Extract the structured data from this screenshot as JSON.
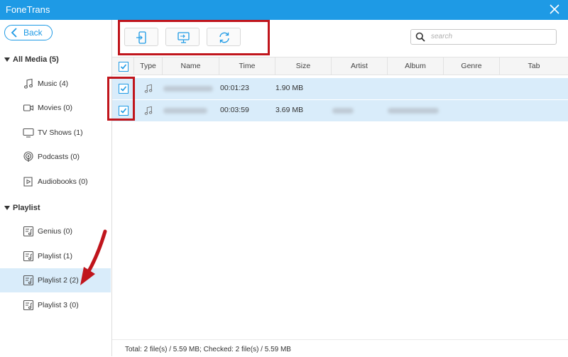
{
  "app": {
    "title": "FoneTrans"
  },
  "sidebar": {
    "back_label": "Back",
    "groups": [
      {
        "label": "All Media (5)"
      },
      {
        "label": "Playlist"
      }
    ],
    "media_items": [
      {
        "label": "Music (4)",
        "icon": "music-note-icon"
      },
      {
        "label": "Movies (0)",
        "icon": "movie-camera-icon"
      },
      {
        "label": "TV Shows (1)",
        "icon": "tv-icon"
      },
      {
        "label": "Podcasts (0)",
        "icon": "podcast-icon"
      },
      {
        "label": "Audiobooks (0)",
        "icon": "audiobook-icon"
      }
    ],
    "playlist_items": [
      {
        "label": "Genius (0)",
        "icon": "playlist-icon"
      },
      {
        "label": "Playlist (1)",
        "icon": "playlist-icon"
      },
      {
        "label": "Playlist 2 (2)",
        "icon": "playlist-icon",
        "active": true
      },
      {
        "label": "Playlist 3 (0)",
        "icon": "playlist-icon"
      }
    ]
  },
  "toolbar": {
    "buttons": [
      {
        "icon": "export-to-device-icon"
      },
      {
        "icon": "export-to-pc-icon"
      },
      {
        "icon": "refresh-icon"
      }
    ]
  },
  "search": {
    "placeholder": "search"
  },
  "table": {
    "columns": [
      "Type",
      "Name",
      "Time",
      "Size",
      "Artist",
      "Album",
      "Genre",
      "Tab"
    ],
    "rows": [
      {
        "checked": true,
        "type_icon": "music-note-icon",
        "time": "00:01:23",
        "size": "1.90 MB"
      },
      {
        "checked": true,
        "type_icon": "music-note-icon",
        "time": "00:03:59",
        "size": "3.69 MB"
      }
    ]
  },
  "footer": {
    "status": "Total: 2 file(s) / 5.59 MB; Checked: 2 file(s) / 5.59 MB"
  },
  "colors": {
    "accent": "#1e9ae5",
    "selection": "#d9ecfa",
    "annotation": "#c0151c"
  }
}
